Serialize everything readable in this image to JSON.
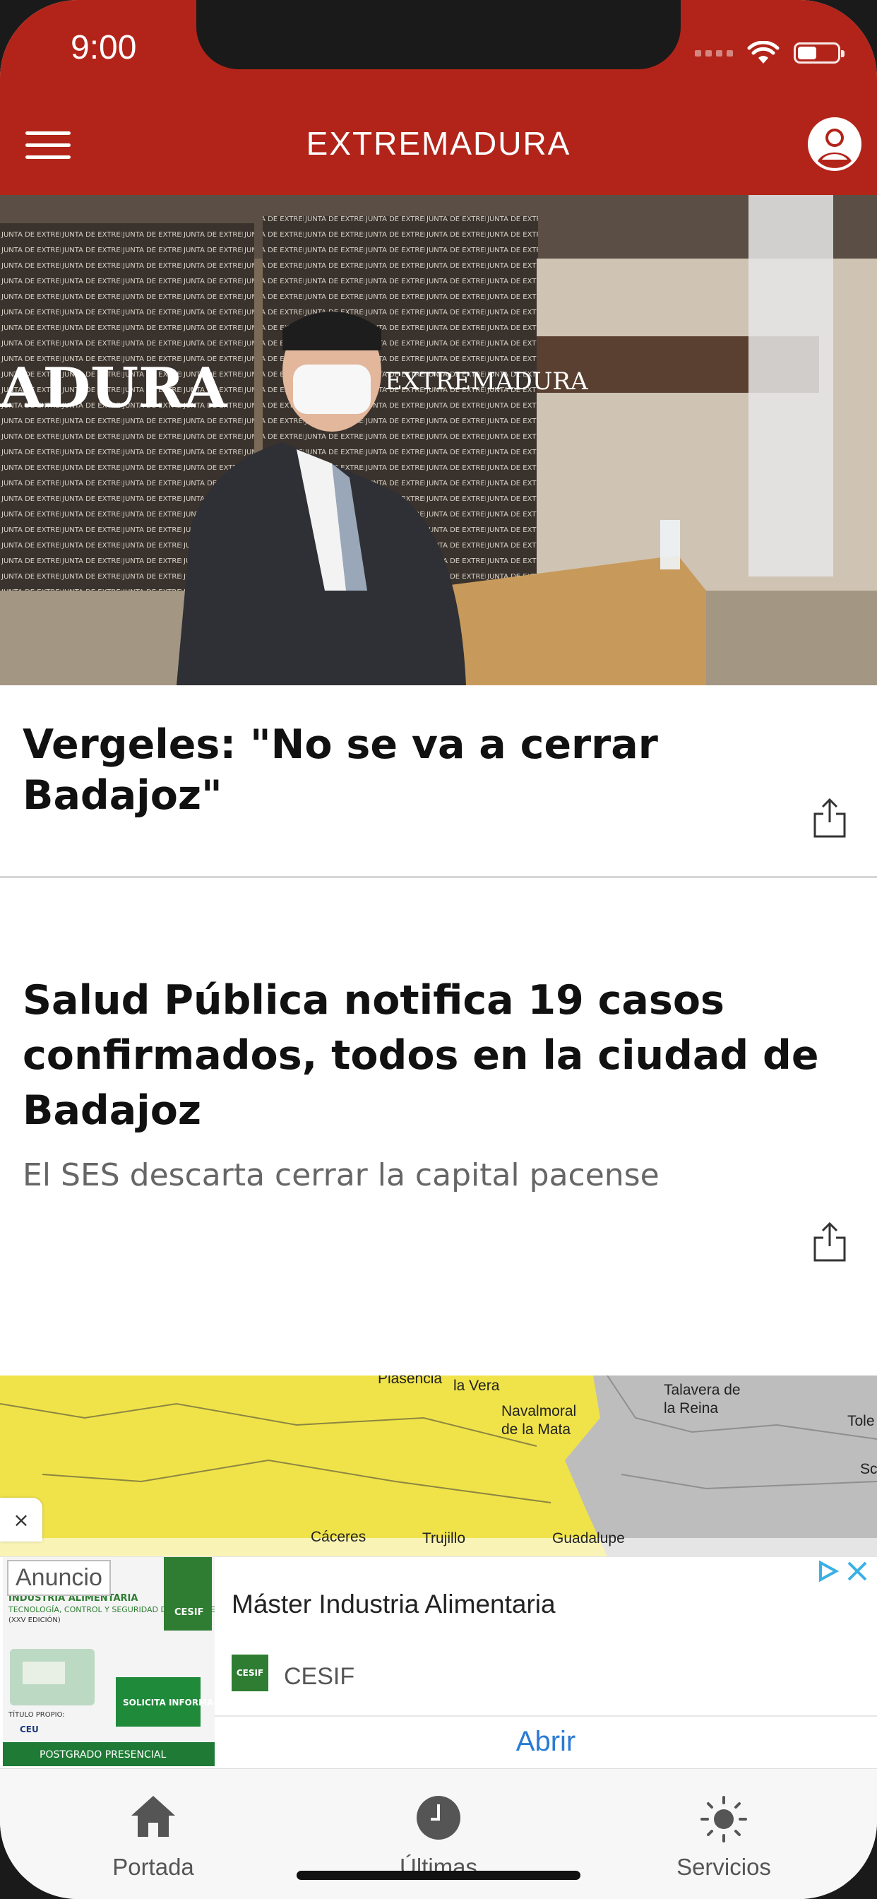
{
  "status_bar": {
    "time": "9:00"
  },
  "header": {
    "title": "EXTREMADURA"
  },
  "hero": {
    "banner_text": "ADURA",
    "podium_text": "EXTREMADURA"
  },
  "articles": [
    {
      "title": "Vergeles: \"No se va a cerrar Badajoz\"",
      "subtitle": ""
    },
    {
      "title": "Salud Pública notifica 19 casos confirmados, todos en la ciudad de Badajoz",
      "subtitle": "El SES descarta cerrar la capital pacense"
    }
  ],
  "map": {
    "labels": [
      "Plasencia",
      "la Vera",
      "Navalmoral de la Mata",
      "Talavera de la Reina",
      "Tole",
      "Cáceres",
      "Trujillo",
      "Guadalupe",
      "Sc"
    ]
  },
  "ad": {
    "label": "Anuncio",
    "title": "Máster Industria Alimentaria",
    "brand": "CESIF",
    "cta": "Abrir",
    "image_texts": [
      "INDUSTRIA ALIMENTARIA",
      "TECNOLOGÍA, CONTROL Y SEGURIDAD DE LOS ALIMENTOS",
      "(XXV EDICIÓN)",
      "TÍTULO PROPIO:",
      "CEU",
      "SOLICITA INFORMACIÓN",
      "POSTGRADO PRESENCIAL"
    ],
    "close_symbol": "×"
  },
  "tabbar": {
    "items": [
      {
        "label": "Portada",
        "icon": "home-icon"
      },
      {
        "label": "Últimas",
        "icon": "clock-icon"
      },
      {
        "label": "Servicios",
        "icon": "sun-icon"
      }
    ]
  },
  "colors": {
    "brand": "#b22419",
    "link": "#2a7bd4",
    "map_yellow": "#f0e34a"
  }
}
